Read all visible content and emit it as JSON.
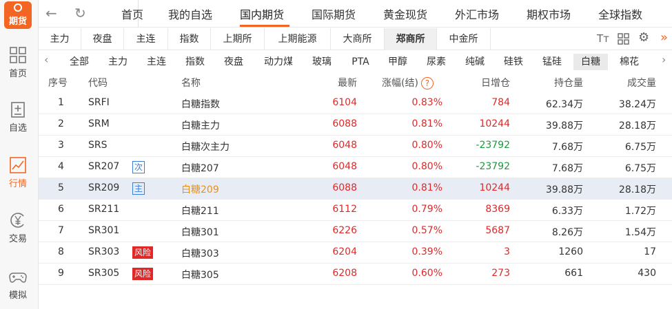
{
  "app": {
    "logo_text": "期货"
  },
  "sidebar": {
    "items": [
      {
        "label": "首页",
        "icon": "grid-icon"
      },
      {
        "label": "自选",
        "icon": "watchlist-icon"
      },
      {
        "label": "行情",
        "icon": "chart-icon"
      },
      {
        "label": "交易",
        "icon": "yen-icon"
      },
      {
        "label": "模拟",
        "icon": "gamepad-icon"
      }
    ]
  },
  "topnav": {
    "tabs": [
      "首页",
      "我的自选",
      "国内期货",
      "国际期货",
      "黄金现货",
      "外汇市场",
      "期权市场",
      "全球指数"
    ],
    "active": "国内期货"
  },
  "exchanges": [
    "主力",
    "夜盘",
    "主连",
    "指数",
    "上期所",
    "上期能源",
    "大商所",
    "郑商所",
    "中金所"
  ],
  "active_exchange": "郑商所",
  "tools": {
    "font_icon": "Tт",
    "layout_icon": "layout-icon",
    "settings_icon": "gear-icon",
    "more": "»"
  },
  "categories": [
    "全部",
    "主力",
    "主连",
    "指数",
    "夜盘",
    "动力煤",
    "玻璃",
    "PTA",
    "甲醇",
    "尿素",
    "纯碱",
    "硅铁",
    "锰硅",
    "白糖",
    "棉花"
  ],
  "active_category": "白糖",
  "table": {
    "headers": {
      "idx": "序号",
      "code": "代码",
      "name": "名称",
      "last": "最新",
      "change": "涨幅(结)",
      "help": "?",
      "daily_oi": "日增仓",
      "oi": "持仓量",
      "volume": "成交量"
    },
    "rows": [
      {
        "idx": "1",
        "code": "SRFI",
        "tag": "",
        "name": "白糖指数",
        "last": "6104",
        "change": "0.83%",
        "daily_oi": "784",
        "oi": "62.34万",
        "volume": "38.24万"
      },
      {
        "idx": "2",
        "code": "SRM",
        "tag": "",
        "name": "白糖主力",
        "last": "6088",
        "change": "0.81%",
        "daily_oi": "10244",
        "oi": "39.88万",
        "volume": "28.18万"
      },
      {
        "idx": "3",
        "code": "SRS",
        "tag": "",
        "name": "白糖次主力",
        "last": "6048",
        "change": "0.80%",
        "daily_oi": "-23792",
        "oi": "7.68万",
        "volume": "6.75万"
      },
      {
        "idx": "4",
        "code": "SR207",
        "tag": "次",
        "name": "白糖207",
        "last": "6048",
        "change": "0.80%",
        "daily_oi": "-23792",
        "oi": "7.68万",
        "volume": "6.75万"
      },
      {
        "idx": "5",
        "code": "SR209",
        "tag": "主",
        "name": "白糖209",
        "last": "6088",
        "change": "0.81%",
        "daily_oi": "10244",
        "oi": "39.88万",
        "volume": "28.18万"
      },
      {
        "idx": "6",
        "code": "SR211",
        "tag": "",
        "name": "白糖211",
        "last": "6112",
        "change": "0.79%",
        "daily_oi": "8369",
        "oi": "6.33万",
        "volume": "1.72万"
      },
      {
        "idx": "7",
        "code": "SR301",
        "tag": "",
        "name": "白糖301",
        "last": "6226",
        "change": "0.57%",
        "daily_oi": "5687",
        "oi": "8.26万",
        "volume": "1.54万"
      },
      {
        "idx": "8",
        "code": "SR303",
        "tag": "风险",
        "name": "白糖303",
        "last": "6204",
        "change": "0.39%",
        "daily_oi": "3",
        "oi": "1260",
        "volume": "17"
      },
      {
        "idx": "9",
        "code": "SR305",
        "tag": "风险",
        "name": "白糖305",
        "last": "6208",
        "change": "0.60%",
        "daily_oi": "273",
        "oi": "661",
        "volume": "430"
      }
    ]
  },
  "colors": {
    "accent": "#f26522",
    "up": "#e02828",
    "down": "#1a9a3c",
    "selected_row": "#e8edf5"
  }
}
